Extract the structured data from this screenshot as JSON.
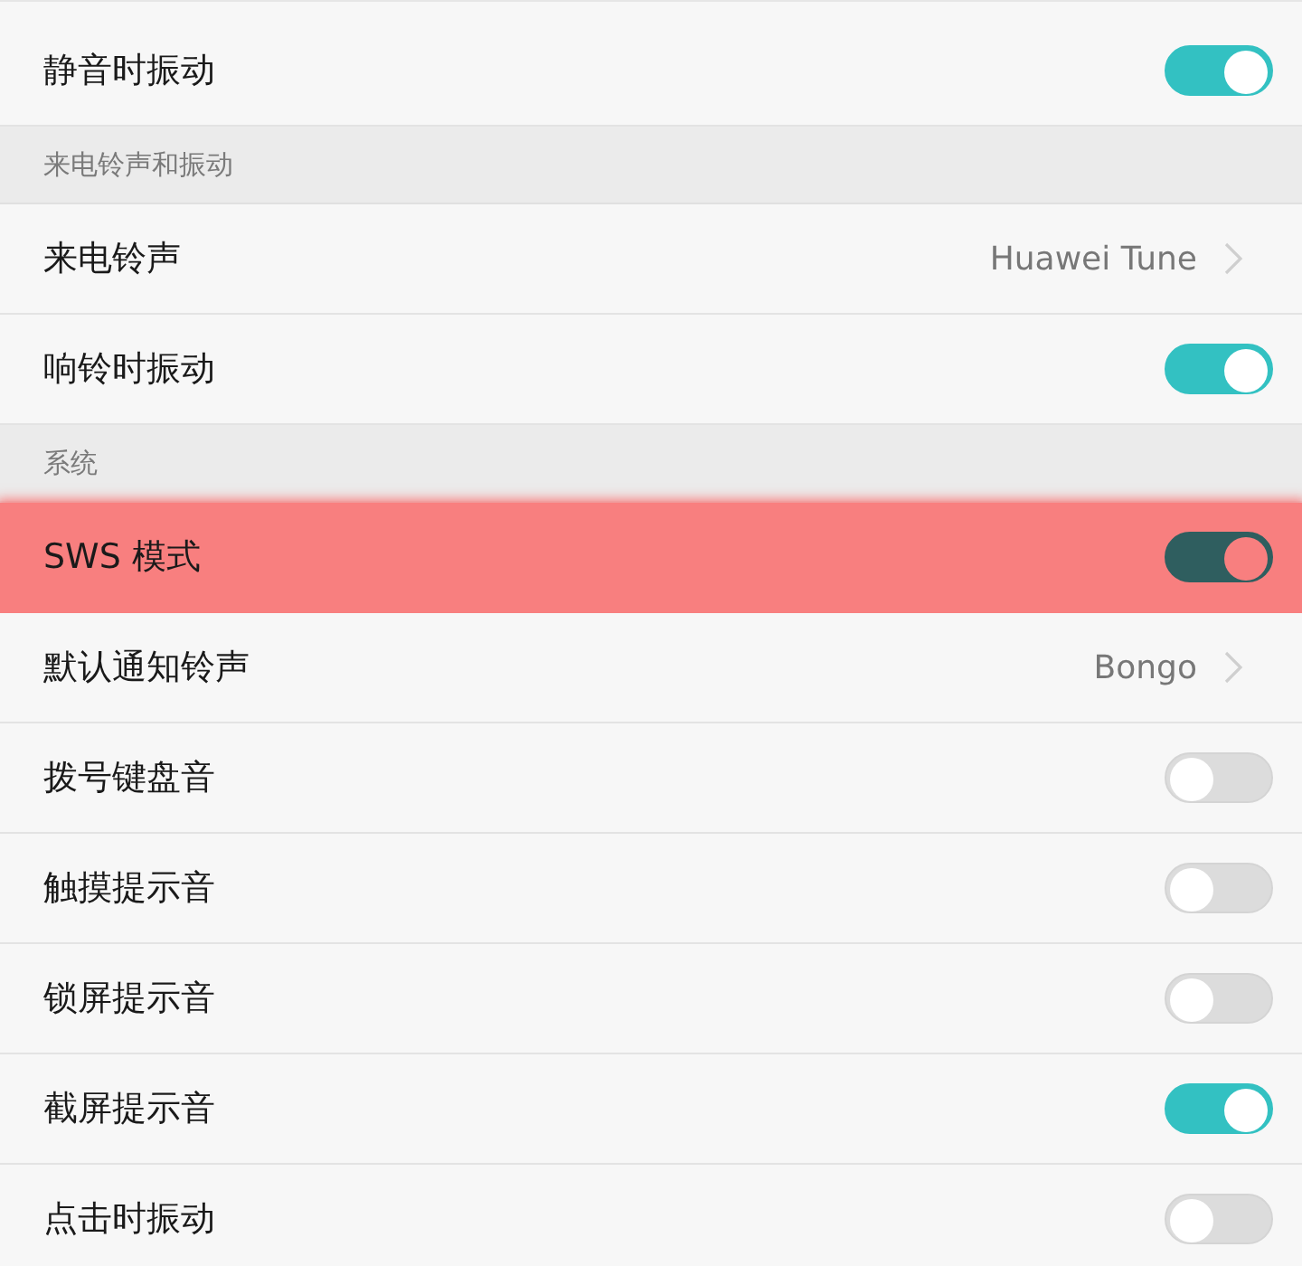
{
  "settings": [
    {
      "kind": "switch",
      "label": "静音时振动",
      "on": true,
      "highlighted": false
    },
    {
      "kind": "header",
      "label": "来电铃声和振动"
    },
    {
      "kind": "link",
      "label": "来电铃声",
      "value": "Huawei Tune",
      "highlighted": false
    },
    {
      "kind": "switch",
      "label": "响铃时振动",
      "on": true,
      "highlighted": false
    },
    {
      "kind": "header",
      "label": "系统"
    },
    {
      "kind": "switch",
      "label": "SWS 模式",
      "on": true,
      "highlighted": true
    },
    {
      "kind": "link",
      "label": "默认通知铃声",
      "value": "Bongo",
      "highlighted": false
    },
    {
      "kind": "switch",
      "label": "拨号键盘音",
      "on": false,
      "highlighted": false
    },
    {
      "kind": "switch",
      "label": "触摸提示音",
      "on": false,
      "highlighted": false
    },
    {
      "kind": "switch",
      "label": "锁屏提示音",
      "on": false,
      "highlighted": false
    },
    {
      "kind": "switch",
      "label": "截屏提示音",
      "on": true,
      "highlighted": false
    },
    {
      "kind": "switch",
      "label": "点击时振动",
      "on": false,
      "highlighted": false
    }
  ]
}
